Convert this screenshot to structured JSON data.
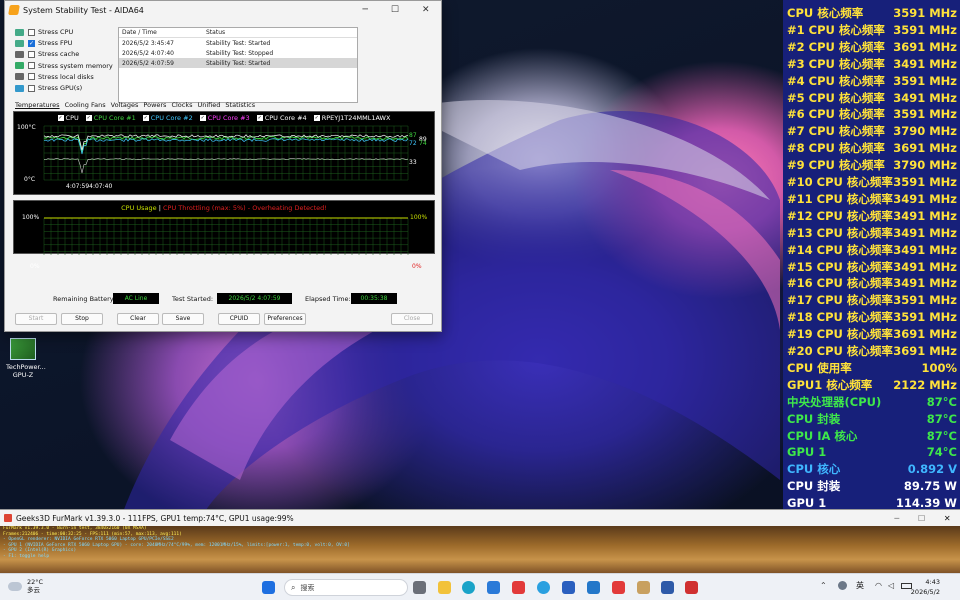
{
  "aida": {
    "title": "System Stability Test - AIDA64",
    "stress": [
      {
        "label": "Stress CPU",
        "checked": false,
        "icon": "cpu-chip-icon"
      },
      {
        "label": "Stress FPU",
        "checked": true,
        "icon": "fpu-chip-icon"
      },
      {
        "label": "Stress cache",
        "checked": false,
        "icon": "cache-icon"
      },
      {
        "label": "Stress system memory",
        "checked": false,
        "icon": "memory-icon"
      },
      {
        "label": "Stress local disks",
        "checked": false,
        "icon": "disk-icon"
      },
      {
        "label": "Stress GPU(s)",
        "checked": false,
        "icon": "gpu-icon"
      }
    ],
    "log": {
      "headers": [
        "Date / Time",
        "Status"
      ],
      "rows": [
        [
          "2026/5/2 3:45:47",
          "Stability Test: Started"
        ],
        [
          "2026/5/2 4:07:40",
          "Stability Test: Stopped"
        ],
        [
          "2026/5/2 4:07:59",
          "Stability Test: Started"
        ]
      ]
    },
    "tabs": [
      "Temperatures",
      "Cooling Fans",
      "Voltages",
      "Powers",
      "Clocks",
      "Unified",
      "Statistics"
    ],
    "temp_legend": [
      {
        "label": "CPU",
        "color": "#ffffff"
      },
      {
        "label": "CPU Core #1",
        "color": "#3fd43f"
      },
      {
        "label": "CPU Core #2",
        "color": "#40c8ff"
      },
      {
        "label": "CPU Core #3",
        "color": "#ff40ff"
      },
      {
        "label": "CPU Core #4",
        "color": "#ffffff"
      },
      {
        "label": "RPEYJ1T24MML1AWX",
        "color": "#ffffff"
      }
    ],
    "temp_axis": {
      "top": "100°C",
      "bottom": "0°C",
      "time": "4:07:594:07:40",
      "right": [
        "87",
        "89",
        "72",
        "74",
        "33"
      ]
    },
    "usage_legend": {
      "a": "CPU Usage",
      "sep": "|",
      "b": "CPU Throttling (max: 5%) - Overheating Detected!"
    },
    "usage_axis": {
      "top_left": "100%",
      "bottom_left": "0%",
      "top_right": "100%",
      "bottom_right": "0%"
    },
    "remaining_battery_label": "Remaining Battery:",
    "remaining_battery": "AC Line",
    "test_started_label": "Test Started:",
    "test_started": "2026/5/2 4:07:59",
    "elapsed_label": "Elapsed Time:",
    "elapsed": "00:35:38",
    "buttons": {
      "start": "Start",
      "stop": "Stop",
      "clear": "Clear",
      "save": "Save",
      "cpuid": "CPUID",
      "preferences": "Preferences",
      "close": "Close"
    }
  },
  "osd": [
    {
      "label": "CPU 核心频率",
      "value": "3591 MHz",
      "color": "#ffe23a"
    },
    {
      "label": "#1 CPU 核心频率",
      "value": "3591 MHz",
      "color": "#ffe23a"
    },
    {
      "label": "#2 CPU 核心频率",
      "value": "3691 MHz",
      "color": "#ffe23a"
    },
    {
      "label": "#3 CPU 核心频率",
      "value": "3491 MHz",
      "color": "#ffe23a"
    },
    {
      "label": "#4 CPU 核心频率",
      "value": "3591 MHz",
      "color": "#ffe23a"
    },
    {
      "label": "#5 CPU 核心频率",
      "value": "3491 MHz",
      "color": "#ffe23a"
    },
    {
      "label": "#6 CPU 核心频率",
      "value": "3591 MHz",
      "color": "#ffe23a"
    },
    {
      "label": "#7 CPU 核心频率",
      "value": "3790 MHz",
      "color": "#ffe23a"
    },
    {
      "label": "#8 CPU 核心频率",
      "value": "3691 MHz",
      "color": "#ffe23a"
    },
    {
      "label": "#9 CPU 核心频率",
      "value": "3790 MHz",
      "color": "#ffe23a"
    },
    {
      "label": "#10 CPU 核心频率",
      "value": "3591 MHz",
      "color": "#ffe23a"
    },
    {
      "label": "#11 CPU 核心频率",
      "value": "3491 MHz",
      "color": "#ffe23a"
    },
    {
      "label": "#12 CPU 核心频率",
      "value": "3491 MHz",
      "color": "#ffe23a"
    },
    {
      "label": "#13 CPU 核心频率",
      "value": "3491 MHz",
      "color": "#ffe23a"
    },
    {
      "label": "#14 CPU 核心频率",
      "value": "3491 MHz",
      "color": "#ffe23a"
    },
    {
      "label": "#15 CPU 核心频率",
      "value": "3491 MHz",
      "color": "#ffe23a"
    },
    {
      "label": "#16 CPU 核心频率",
      "value": "3491 MHz",
      "color": "#ffe23a"
    },
    {
      "label": "#17 CPU 核心频率",
      "value": "3591 MHz",
      "color": "#ffe23a"
    },
    {
      "label": "#18 CPU 核心频率",
      "value": "3591 MHz",
      "color": "#ffe23a"
    },
    {
      "label": "#19 CPU 核心频率",
      "value": "3691 MHz",
      "color": "#ffe23a"
    },
    {
      "label": "#20 CPU 核心频率",
      "value": "3691 MHz",
      "color": "#ffe23a"
    },
    {
      "label": "CPU 使用率",
      "value": "100%",
      "color": "#ffe23a"
    },
    {
      "label": "GPU1 核心频率",
      "value": "2122 MHz",
      "color": "#ffe23a"
    },
    {
      "label": "中央处理器(CPU)",
      "value": "87°C",
      "color": "#3ee84a"
    },
    {
      "label": "CPU 封装",
      "value": "87°C",
      "color": "#3ee84a"
    },
    {
      "label": "CPU IA 核心",
      "value": "87°C",
      "color": "#3ee84a"
    },
    {
      "label": "GPU 1",
      "value": "74°C",
      "color": "#3ee84a"
    },
    {
      "label": "CPU 核心",
      "value": "0.892 V",
      "color": "#3fb6ff"
    },
    {
      "label": "CPU 封装",
      "value": "89.75 W",
      "color": "#ffffff"
    },
    {
      "label": "GPU 1",
      "value": "114.39 W",
      "color": "#ffffff"
    }
  ],
  "desktop_icon": {
    "label1": "TechPower...",
    "label2": "GPU-Z"
  },
  "furmark": {
    "title": "Geeks3D FurMark v1.39.3.0 - 111FPS, GPU1 temp:74°C, GPU1 usage:99%",
    "lines": [
      {
        "text": "FurMark v1.39.3.0 - Burn-in test, 3840x2160 (0X MSAA)",
        "color": "#ffee55"
      },
      {
        "text": "Frames:212406 - time:00:32:25 - FPS:111 (min:57, max:113, avg:111)",
        "color": "#ffee55"
      },
      {
        "text": "- OpenGL renderer: NVIDIA GeForce RTX 5060 Laptop GPU/PCIe/SSE2",
        "color": "#7fd8ff"
      },
      {
        "text": "- GPU 1 (NVIDIA GeForce RTX 5060 Laptop GPU) - core: 2040MHz/74°C/99%, mem: 12001MHz/15%, limits:[power:1, temp:0, volt:0, OV:0]",
        "color": "#7fd8ff"
      },
      {
        "text": "- GPU 2 (Intel(R) Graphics)",
        "color": "#7fd8ff"
      },
      {
        "text": "- F1: toggle help",
        "color": "#7fd8ff"
      }
    ]
  },
  "taskbar": {
    "weather_temp": "22°C",
    "weather_text": "多云",
    "search_placeholder": "搜索",
    "ime": "英",
    "time": "4:43",
    "date": "2026/5/2"
  }
}
